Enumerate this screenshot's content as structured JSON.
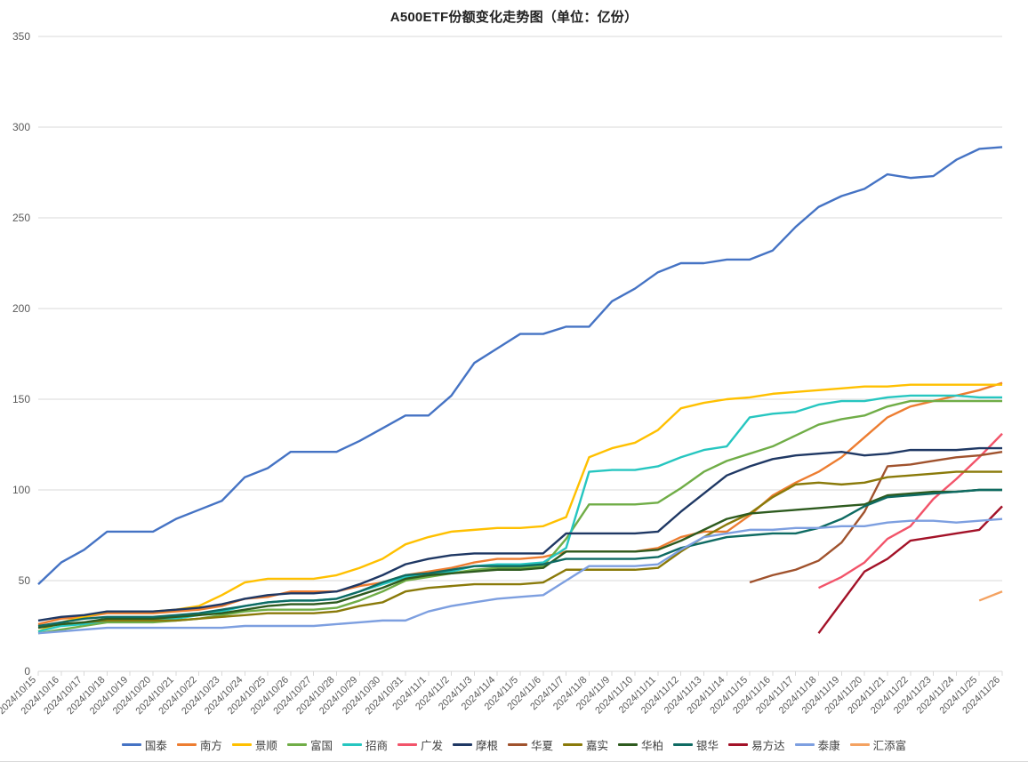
{
  "chart_data": {
    "type": "line",
    "title": "A500ETF份额变化走势图（单位：亿份）",
    "xlabel": "",
    "ylabel": "",
    "ylim": [
      0,
      350
    ],
    "ytick_step": 50,
    "yticks": [
      "0",
      "50",
      "100",
      "150",
      "200",
      "250",
      "300",
      "350"
    ],
    "grid": true,
    "legend_position": "bottom",
    "categories": [
      "2024/10/15",
      "2024/10/16",
      "2024/10/17",
      "2024/10/18",
      "2024/10/19",
      "2024/10/20",
      "2024/10/21",
      "2024/10/22",
      "2024/10/23",
      "2024/10/24",
      "2024/10/25",
      "2024/10/26",
      "2024/10/27",
      "2024/10/28",
      "2024/10/29",
      "2024/10/30",
      "2024/10/31",
      "2024/11/1",
      "2024/11/2",
      "2024/11/3",
      "2024/11/4",
      "2024/11/5",
      "2024/11/6",
      "2024/11/7",
      "2024/11/8",
      "2024/11/9",
      "2024/11/10",
      "2024/11/11",
      "2024/11/12",
      "2024/11/13",
      "2024/11/14",
      "2024/11/15",
      "2024/11/16",
      "2024/11/17",
      "2024/11/18",
      "2024/11/19",
      "2024/11/20",
      "2024/11/21",
      "2024/11/22",
      "2024/11/23",
      "2024/11/24",
      "2024/11/25",
      "2024/11/26"
    ],
    "series": [
      {
        "name": "国泰",
        "color": "#4573c4",
        "values": [
          48,
          60,
          67,
          77,
          77,
          77,
          84,
          89,
          94,
          107,
          112,
          121,
          121,
          121,
          127,
          134,
          141,
          141,
          152,
          170,
          178,
          186,
          186,
          190,
          190,
          204,
          211,
          220,
          225,
          225,
          227,
          227,
          232,
          245,
          256,
          262,
          266,
          274,
          272,
          273,
          282,
          288,
          289
        ]
      },
      {
        "name": "南方",
        "color": "#ed7d31",
        "values": [
          26,
          29,
          30,
          32,
          32,
          32,
          33,
          34,
          36,
          40,
          41,
          44,
          44,
          44,
          47,
          49,
          53,
          55,
          57,
          60,
          62,
          62,
          63,
          66,
          66,
          66,
          66,
          68,
          74,
          77,
          77,
          86,
          97,
          104,
          110,
          118,
          129,
          140,
          146,
          149,
          152,
          155,
          159
        ]
      },
      {
        "name": "景顺",
        "color": "#ffc000",
        "values": [
          22,
          27,
          30,
          33,
          33,
          33,
          34,
          36,
          42,
          49,
          51,
          51,
          51,
          53,
          57,
          62,
          70,
          74,
          77,
          78,
          79,
          79,
          80,
          85,
          118,
          123,
          126,
          133,
          145,
          148,
          150,
          151,
          153,
          154,
          155,
          156,
          157,
          157,
          158,
          158,
          158,
          158,
          158
        ]
      },
      {
        "name": "富国",
        "color": "#70ad47"
      },
      {
        "name": "招商",
        "color": "#26c6c0"
      },
      {
        "name": "广发",
        "color": "#f2546a"
      },
      {
        "name": "摩根",
        "color": "#1f3864"
      },
      {
        "name": "华夏",
        "color": "#a0522d"
      },
      {
        "name": "嘉实",
        "color": "#8a7a0a"
      },
      {
        "name": "华柏",
        "color": "#2e5b1f"
      },
      {
        "name": "银华",
        "color": "#0f6b63"
      },
      {
        "name": "易方达",
        "color": "#a31228"
      },
      {
        "name": "泰康",
        "color": "#7d9fe0"
      },
      {
        "name": "汇添富",
        "color": "#f4a261"
      }
    ],
    "series_values": {
      "国泰": [
        48,
        60,
        67,
        77,
        77,
        77,
        84,
        89,
        94,
        107,
        112,
        121,
        121,
        121,
        127,
        134,
        141,
        141,
        152,
        170,
        178,
        186,
        186,
        190,
        190,
        204,
        211,
        220,
        225,
        225,
        227,
        227,
        232,
        245,
        256,
        262,
        266,
        274,
        272,
        273,
        282,
        288,
        289
      ],
      "南方": [
        26,
        29,
        30,
        32,
        32,
        32,
        33,
        34,
        36,
        40,
        41,
        44,
        44,
        44,
        47,
        49,
        53,
        55,
        57,
        60,
        62,
        62,
        63,
        66,
        66,
        66,
        66,
        68,
        74,
        77,
        77,
        86,
        97,
        104,
        110,
        118,
        129,
        140,
        146,
        149,
        152,
        155,
        159
      ],
      "景顺": [
        22,
        27,
        30,
        33,
        33,
        33,
        34,
        36,
        42,
        49,
        51,
        51,
        51,
        53,
        57,
        62,
        70,
        74,
        77,
        78,
        79,
        79,
        80,
        85,
        118,
        123,
        126,
        133,
        145,
        148,
        150,
        151,
        153,
        154,
        155,
        156,
        157,
        157,
        158,
        158,
        158,
        158,
        158
      ],
      "富国": [
        21,
        23,
        25,
        27,
        27,
        27,
        28,
        29,
        31,
        33,
        34,
        34,
        34,
        35,
        39,
        44,
        50,
        52,
        54,
        56,
        57,
        57,
        58,
        73,
        92,
        92,
        92,
        93,
        101,
        110,
        116,
        120,
        124,
        130,
        136,
        139,
        141,
        146,
        149,
        149,
        149,
        149,
        149
      ],
      "招商": [
        22,
        25,
        26,
        28,
        28,
        28,
        29,
        31,
        33,
        36,
        38,
        39,
        39,
        40,
        44,
        48,
        52,
        53,
        55,
        58,
        59,
        59,
        60,
        68,
        110,
        111,
        111,
        113,
        118,
        122,
        124,
        140,
        142,
        143,
        147,
        149,
        149,
        151,
        152,
        152,
        152,
        151,
        151
      ],
      "广发": [
        null,
        null,
        null,
        null,
        null,
        null,
        null,
        null,
        null,
        null,
        null,
        null,
        null,
        null,
        null,
        null,
        null,
        null,
        null,
        null,
        null,
        null,
        null,
        null,
        null,
        null,
        null,
        null,
        null,
        null,
        null,
        null,
        null,
        null,
        46,
        52,
        60,
        73,
        80,
        95,
        106,
        118,
        131
      ],
      "摩根": [
        28,
        30,
        31,
        33,
        33,
        33,
        34,
        35,
        37,
        40,
        42,
        43,
        43,
        44,
        48,
        53,
        59,
        62,
        64,
        65,
        65,
        65,
        65,
        76,
        76,
        76,
        76,
        77,
        88,
        98,
        108,
        113,
        117,
        119,
        120,
        121,
        119,
        120,
        122,
        122,
        122,
        123,
        123
      ],
      "华夏": [
        null,
        null,
        null,
        null,
        null,
        null,
        null,
        null,
        null,
        null,
        null,
        null,
        null,
        null,
        null,
        null,
        null,
        null,
        null,
        null,
        null,
        null,
        null,
        null,
        null,
        null,
        null,
        null,
        null,
        null,
        null,
        49,
        53,
        56,
        61,
        71,
        88,
        113,
        114,
        116,
        118,
        119,
        121
      ],
      "嘉实": [
        25,
        26,
        27,
        28,
        28,
        28,
        28,
        29,
        30,
        31,
        32,
        32,
        32,
        33,
        36,
        38,
        44,
        46,
        47,
        48,
        48,
        48,
        49,
        56,
        56,
        56,
        56,
        57,
        66,
        74,
        81,
        87,
        96,
        103,
        104,
        103,
        104,
        107,
        108,
        109,
        110,
        110,
        110
      ],
      "华柏": [
        24,
        26,
        27,
        29,
        29,
        29,
        30,
        31,
        32,
        34,
        36,
        37,
        37,
        38,
        42,
        46,
        51,
        53,
        54,
        55,
        56,
        56,
        57,
        66,
        66,
        66,
        66,
        67,
        72,
        78,
        84,
        87,
        88,
        89,
        90,
        91,
        92,
        97,
        98,
        99,
        99,
        100,
        100
      ],
      "银华": [
        25,
        27,
        29,
        30,
        30,
        30,
        31,
        32,
        34,
        36,
        38,
        39,
        39,
        40,
        44,
        49,
        53,
        54,
        56,
        58,
        58,
        58,
        59,
        62,
        62,
        62,
        62,
        63,
        68,
        71,
        74,
        75,
        76,
        76,
        79,
        84,
        91,
        96,
        97,
        98,
        99,
        100,
        100
      ],
      "易方达": [
        null,
        null,
        null,
        null,
        null,
        null,
        null,
        null,
        null,
        null,
        null,
        null,
        null,
        null,
        null,
        null,
        null,
        null,
        null,
        null,
        null,
        null,
        null,
        null,
        null,
        null,
        null,
        null,
        null,
        null,
        null,
        null,
        null,
        null,
        21,
        38,
        55,
        62,
        72,
        74,
        76,
        78,
        91
      ],
      "泰康": [
        21,
        22,
        23,
        24,
        24,
        24,
        24,
        24,
        24,
        25,
        25,
        25,
        25,
        26,
        27,
        28,
        28,
        33,
        36,
        38,
        40,
        41,
        42,
        50,
        58,
        58,
        58,
        59,
        67,
        74,
        76,
        78,
        78,
        79,
        79,
        80,
        80,
        82,
        83,
        83,
        82,
        83,
        84
      ],
      "汇添富": [
        null,
        null,
        null,
        null,
        null,
        null,
        null,
        null,
        null,
        null,
        null,
        null,
        null,
        null,
        null,
        null,
        null,
        null,
        null,
        null,
        null,
        null,
        null,
        null,
        null,
        null,
        null,
        null,
        null,
        null,
        null,
        null,
        null,
        null,
        null,
        null,
        null,
        null,
        null,
        null,
        null,
        39,
        44
      ]
    }
  },
  "legend": {
    "items": [
      {
        "label": "国泰"
      },
      {
        "label": "南方"
      },
      {
        "label": "景顺"
      },
      {
        "label": "富国"
      },
      {
        "label": "招商"
      },
      {
        "label": "广发"
      },
      {
        "label": "摩根"
      },
      {
        "label": "华夏"
      },
      {
        "label": "嘉实"
      },
      {
        "label": "华柏"
      },
      {
        "label": "银华"
      },
      {
        "label": "易方达"
      },
      {
        "label": "泰康"
      },
      {
        "label": "汇添富"
      }
    ]
  }
}
